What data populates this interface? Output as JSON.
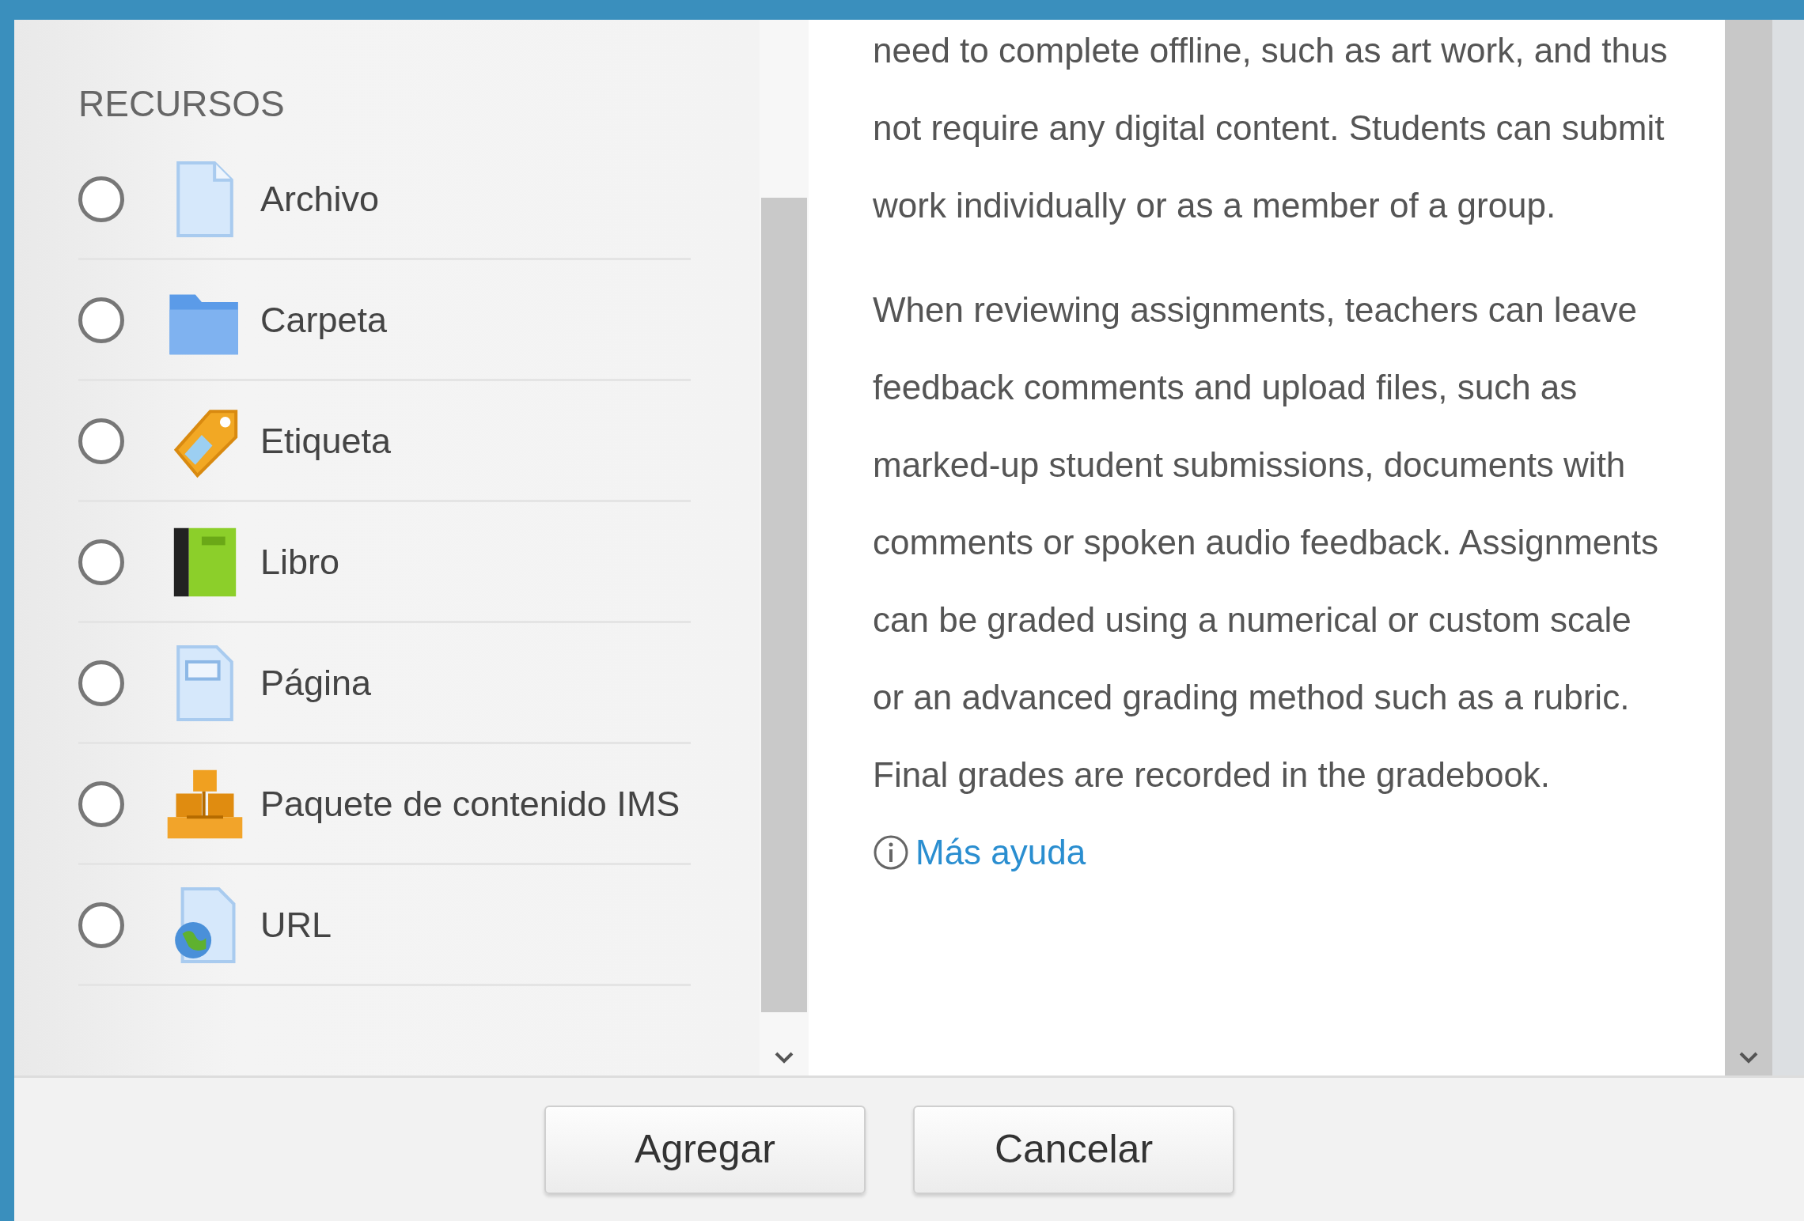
{
  "chooser": {
    "heading": "RECURSOS",
    "options": [
      {
        "label": "Archivo",
        "kind": "file",
        "selected": false
      },
      {
        "label": "Carpeta",
        "kind": "folder",
        "selected": false
      },
      {
        "label": "Etiqueta",
        "kind": "tag",
        "selected": false
      },
      {
        "label": "Libro",
        "kind": "book",
        "selected": false
      },
      {
        "label": "Página",
        "kind": "page",
        "selected": false
      },
      {
        "label": "Paquete de contenido IMS",
        "kind": "package",
        "selected": false
      },
      {
        "label": "URL",
        "kind": "url",
        "selected": false
      }
    ]
  },
  "description": {
    "paragraphs": [
      "need to complete offline, such as art work, and thus not require any digital content. Students can submit work individually or as a member of a group.",
      "When reviewing assignments, teachers can leave feedback comments and upload files, such as marked-up student submissions, documents with comments or spoken audio feedback. Assignments can be graded using a numerical or custom scale or an advanced grading method such as a rubric. Final grades are recorded in the gradebook."
    ],
    "help_link": "Más ayuda"
  },
  "buttons": [
    "Agregar",
    "Cancelar"
  ]
}
